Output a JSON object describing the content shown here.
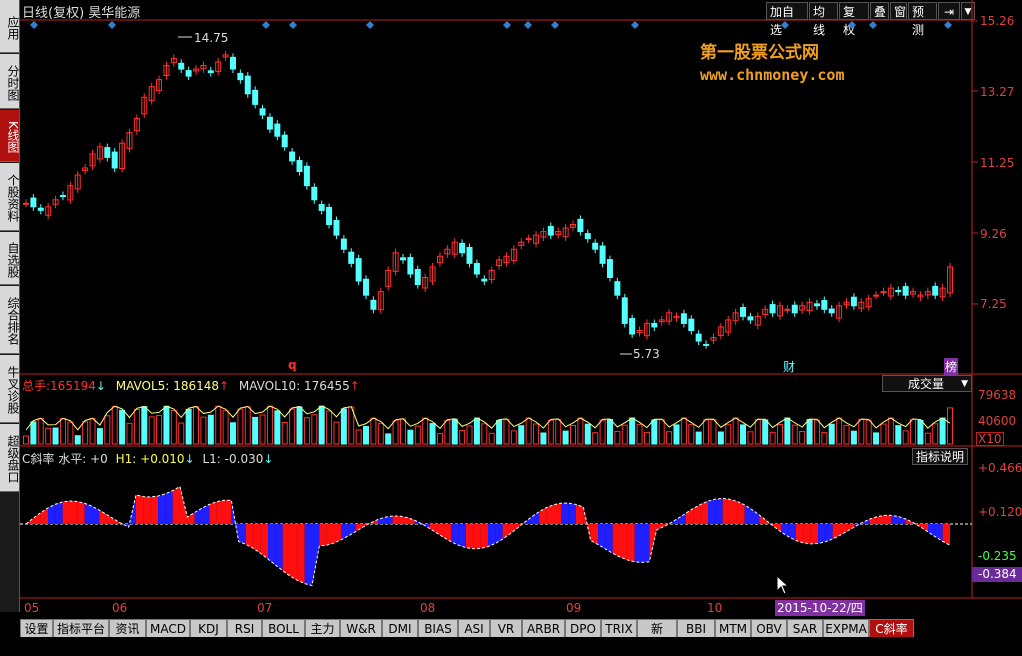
{
  "header": {
    "title": "日线(复权) 昊华能源",
    "buttons": [
      "加自选",
      "均线",
      "复权",
      "叠",
      "窗",
      "预测"
    ]
  },
  "left_nav": [
    {
      "label": "应用",
      "active": false
    },
    {
      "label": "分时图",
      "active": false
    },
    {
      "label": "K线图",
      "active": true
    },
    {
      "label": "个股资料",
      "active": false
    },
    {
      "label": "自选股",
      "active": false
    },
    {
      "label": "综合排名",
      "active": false
    },
    {
      "label": "牛叉诊股",
      "active": false
    },
    {
      "label": "超级盘口",
      "active": false
    }
  ],
  "price_axis": [
    "15.26",
    "13.27",
    "11.25",
    "9.26",
    "7.25"
  ],
  "price_annotations": {
    "high": "14.75",
    "low": "5.73"
  },
  "markers": {
    "q": "q",
    "cai": "财",
    "bang": "榜"
  },
  "watermark": {
    "line1": "第一股票公式网",
    "line2": "www.chnmoney.com"
  },
  "volume": {
    "total_label": "总手:",
    "total_value": "165194",
    "ma5_label": "MAVOL5:",
    "ma5_value": "186148",
    "ma10_label": "MAVOL10:",
    "ma10_value": "176455",
    "dropdown": "成交量",
    "axis": [
      "79638",
      "40600"
    ],
    "axis_unit": "X10"
  },
  "indicator": {
    "name": "C斜率",
    "level_label": "水平:",
    "level_value": "+0",
    "h1_label": "H1:",
    "h1_value": "+0.010",
    "l1_label": "L1:",
    "l1_value": "-0.030",
    "help_button": "指标说明",
    "axis": [
      "+0.466",
      "+0.120",
      "-0.235"
    ],
    "axis_current": "-0.384"
  },
  "x_axis": [
    "05",
    "06",
    "07",
    "08",
    "09",
    "10"
  ],
  "date_cursor": "2015-10-22/四",
  "bottom_tabs": [
    "设置",
    "指标平台",
    "资讯",
    "MACD",
    "KDJ",
    "RSI",
    "BOLL",
    "主力",
    "W&R",
    "DMI",
    "BIAS",
    "ASI",
    "VR",
    "ARBR",
    "DPO",
    "TRIX",
    "新DMA",
    "BBI",
    "MTM",
    "OBV",
    "SAR",
    "EXPMA",
    "C斜率"
  ],
  "bottom_active": "C斜率",
  "colors": {
    "up": "#ff3030",
    "down": "#54ffff",
    "axis": "#c02020",
    "yellow": "#ffff40"
  }
}
